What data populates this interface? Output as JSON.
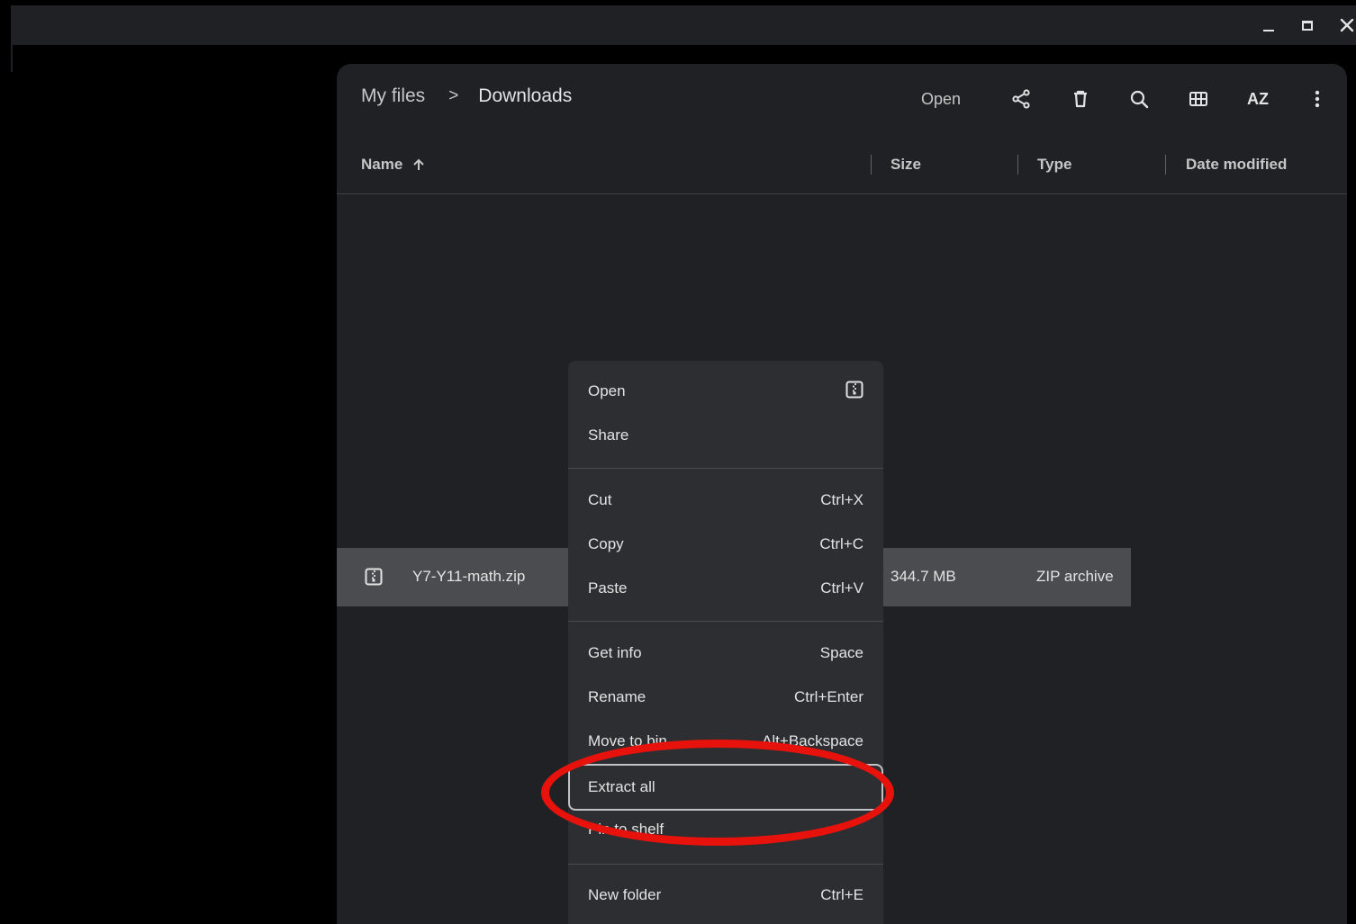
{
  "window": {
    "controls": {
      "minimize": "minimize-icon",
      "maximize": "maximize-icon",
      "close": "close-icon"
    }
  },
  "breadcrumb": {
    "root": "My files",
    "separator": ">",
    "current": "Downloads"
  },
  "toolbar": {
    "open_label": "Open",
    "sort_label": "AZ",
    "icons": [
      "share-icon",
      "delete-icon",
      "search-icon",
      "grid-view-icon",
      "sort-icon",
      "more-vert-icon"
    ]
  },
  "columns": {
    "name": "Name",
    "size": "Size",
    "type": "Type",
    "date": "Date modified"
  },
  "files": [
    {
      "name": "Y7-Y11-math.zip",
      "size": "344.7 MB",
      "type": "ZIP archive",
      "icon": "zip-file-icon"
    }
  ],
  "context_menu": {
    "items": [
      {
        "label": "Open",
        "shortcut": ""
      },
      {
        "label": "Share",
        "shortcut": ""
      },
      {
        "label": "Cut",
        "shortcut": "Ctrl+X"
      },
      {
        "label": "Copy",
        "shortcut": "Ctrl+C"
      },
      {
        "label": "Paste",
        "shortcut": "Ctrl+V"
      },
      {
        "label": "Get info",
        "shortcut": "Space"
      },
      {
        "label": "Rename",
        "shortcut": "Ctrl+Enter"
      },
      {
        "label": "Move to bin",
        "shortcut": "Alt+Backspace"
      },
      {
        "label": "Extract all",
        "shortcut": ""
      },
      {
        "label": "Pin to shelf",
        "shortcut": ""
      },
      {
        "label": "New folder",
        "shortcut": "Ctrl+E"
      }
    ],
    "focused_item": "Extract all"
  },
  "colors": {
    "annotation_ring": "#e8120c",
    "selected_row": "#4b4c4f",
    "menu_bg": "#2d2e31"
  }
}
